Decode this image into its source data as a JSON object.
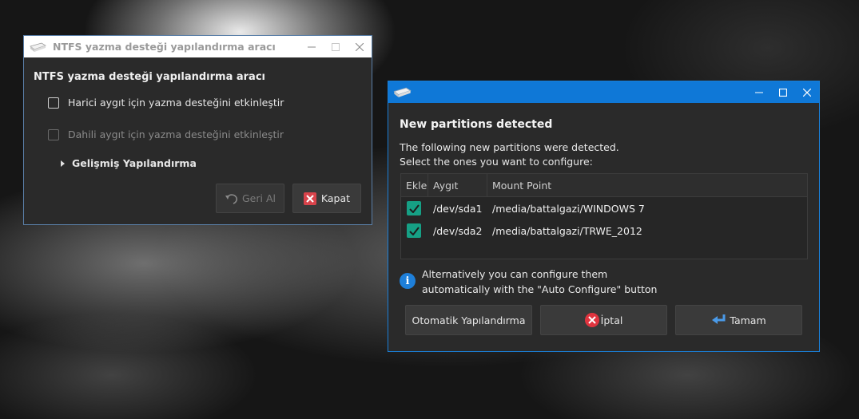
{
  "ntfs_window": {
    "title": "NTFS yazma desteği yapılandırma aracı",
    "heading": "NTFS yazma desteği yapılandırma aracı",
    "external_option": "Harici aygıt için yazma desteğini etkinleştir",
    "internal_option": "Dahili aygıt için yazma desteğini etkinleştir",
    "advanced_label": "Gelişmiş Yapılandırma",
    "revert_label": "Geri Al",
    "close_label": "Kapat"
  },
  "partitions_window": {
    "heading": "New partitions detected",
    "description_line1": "The following new partitions were detected.",
    "description_line2": "Select the ones you want to configure:",
    "columns": [
      "Ekle",
      "Aygıt",
      "Mount Point"
    ],
    "rows": [
      {
        "device": "/dev/sda1",
        "mount": "/media/battalgazi/WINDOWS 7",
        "checked": true
      },
      {
        "device": "/dev/sda2",
        "mount": "/media/battalgazi/TRWE_2012",
        "checked": true
      }
    ],
    "info_line1": "Alternatively you can configure them",
    "info_line2": "automatically with the \"Auto Configure\" button",
    "auto_configure_label": "Otomatik Yapılandırma",
    "cancel_label": "İptal",
    "ok_label": "Tamam"
  },
  "colors": {
    "titlebar_blue": "#0f78d7",
    "check_teal": "#16a085",
    "window_bg": "#2a2a2a",
    "close_red": "#d9434b"
  }
}
